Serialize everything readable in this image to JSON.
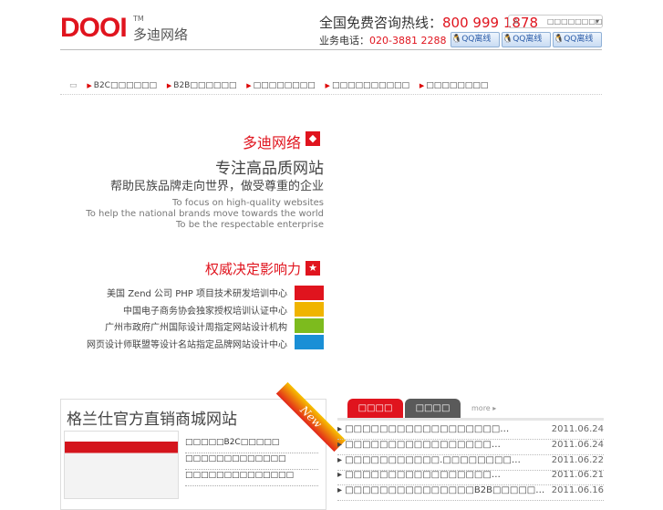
{
  "header": {
    "logo": "DOOI",
    "tm": "TM",
    "logo_cn": "多迪网络",
    "hotline_label": "全国免费咨询热线：",
    "hotline": "800 999 1878",
    "biz_label": "业务电话：",
    "biz_phone": "020-3881 2288",
    "select_value": "□□□□□□□□",
    "qq": [
      "QQ离线",
      "QQ离线",
      "QQ离线"
    ]
  },
  "nav": [
    "B2C□□□□□□",
    "B2B□□□□□□",
    "□□□□□□□□",
    "□□□□□□□□□□",
    "□□□□□□□□"
  ],
  "banner": {
    "brand": "多迪网络",
    "slogan1": "专注高品质网站",
    "slogan2": "帮助民族品牌走向世界，做受尊重的企业",
    "en": [
      "To focus on high-quality websites",
      "To help the national brands move towards the world",
      "To be the respectable enterprise"
    ],
    "authority": "权威决定影响力",
    "items": [
      "美国 Zend 公司 PHP 项目技术研发培训中心",
      "中国电子商务协会独家授权培训认证中心",
      "广州市政府广州国际设计周指定网站设计机构",
      "网页设计师联盟等设计名站指定品牌网站设计中心"
    ],
    "colors": [
      "#e0141e",
      "#f0b400",
      "#7dbb1e",
      "#1a8fd6"
    ]
  },
  "case": {
    "title": "格兰仕官方直销商城网站",
    "ribbon": "New",
    "links": [
      "□□□□□B2C□□□□□",
      "□□□□□□□□□□□□□",
      "□□□□□□□□□□□□□□"
    ]
  },
  "news": {
    "tabs": [
      "□□□□",
      "□□□□"
    ],
    "more": "more",
    "items": [
      {
        "t": "□□□□□□□□□□□□□□□□□□…",
        "d": "2011.06.24"
      },
      {
        "t": "□□□□□□□□□□□□□□□□□…",
        "d": "2011.06.24"
      },
      {
        "t": "□□□□□□□□□□□.□□□□□□□□…",
        "d": "2011.06.22"
      },
      {
        "t": "□□□□□□□□□□□□□□□□□…",
        "d": "2011.06.21"
      },
      {
        "t": "□□□□□□□□□□□□□□□B2B□□□□□…",
        "d": "2011.06.16"
      }
    ]
  }
}
